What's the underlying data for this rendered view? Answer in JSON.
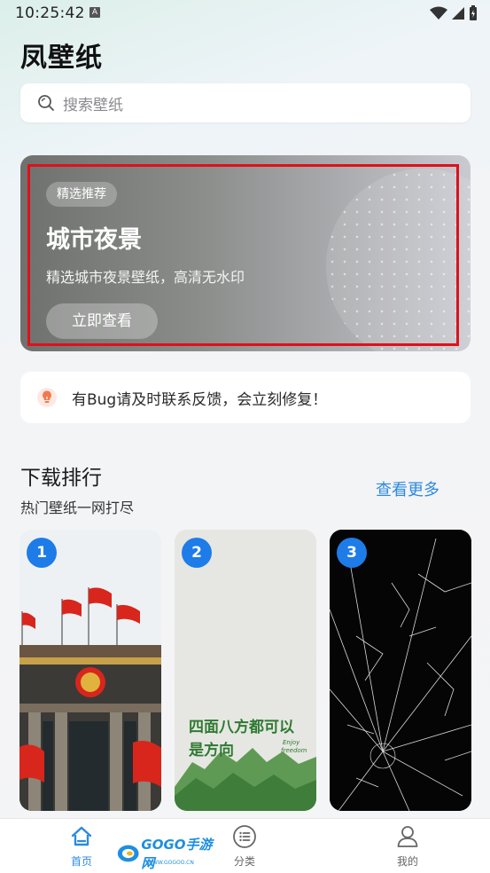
{
  "status_bar": {
    "time": "10:25:42",
    "notif_glyph": "A"
  },
  "app": {
    "title": "凤壁纸"
  },
  "search": {
    "placeholder": "搜索壁纸"
  },
  "banner": {
    "tag": "精选推荐",
    "title": "城市夜景",
    "subtitle": "精选城市夜景壁纸，高清无水印",
    "button": "立即查看"
  },
  "notice": {
    "text": "有Bug请及时联系反馈，会立刻修复！"
  },
  "ranking": {
    "title": "下载排行",
    "subtitle": "热门壁纸一网打尽",
    "more": "查看更多",
    "cards": [
      {
        "rank": "1",
        "image": "tiananmen-flags"
      },
      {
        "rank": "2",
        "image": "green-calligraphy"
      },
      {
        "rank": "3",
        "image": "cracked-glass"
      }
    ],
    "card2_text_main": "四面八方都可以",
    "card2_text_line2": "是方向",
    "card2_text_small_1": "Enjoy",
    "card2_text_small_2": "freedom"
  },
  "tabbar": {
    "home": "首页",
    "category": "分类",
    "mine": "我的",
    "watermark": "GOGO手游网",
    "watermark_url": "WWW.GOGOO.CN"
  },
  "colors": {
    "accent": "#2d8ae0",
    "badge": "#1e7ce8",
    "highlight": "#e0101a"
  }
}
